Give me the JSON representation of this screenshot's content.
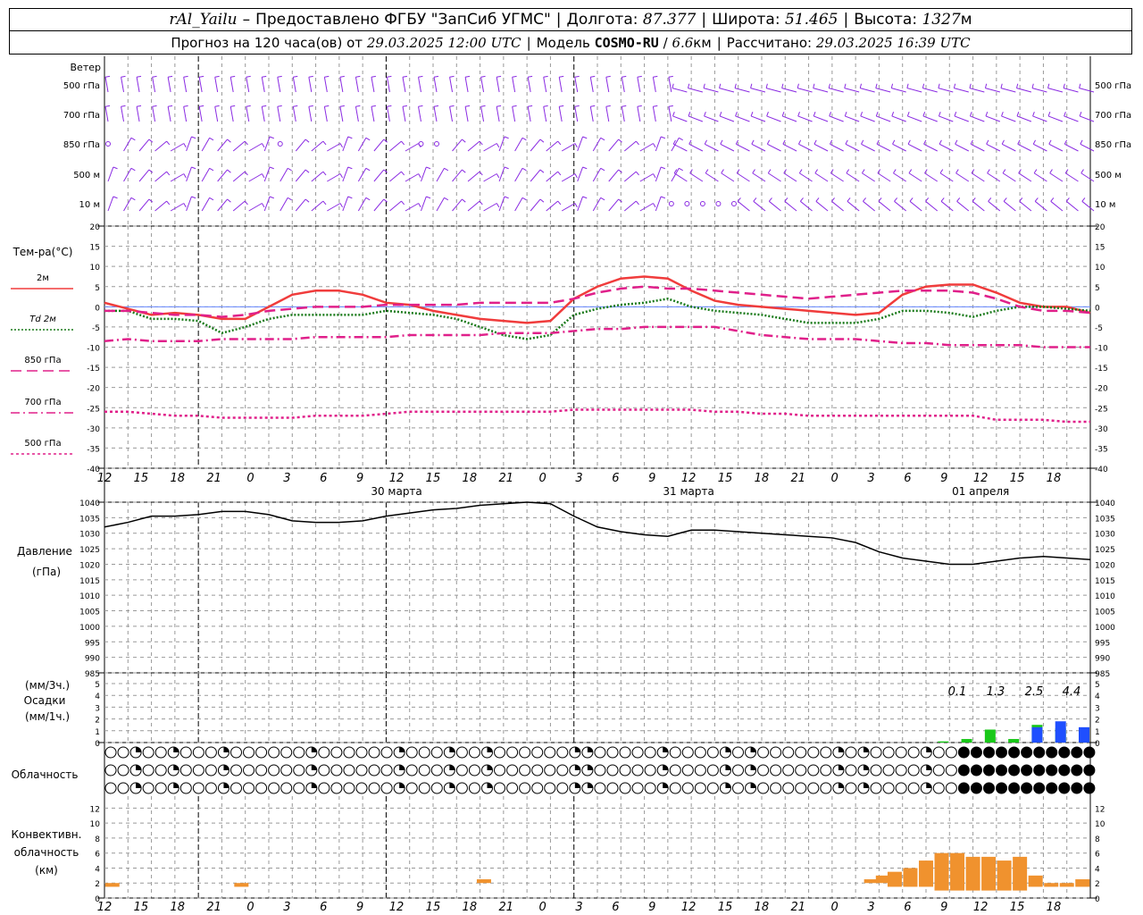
{
  "header": {
    "station": "rAl_Yailu",
    "provider": "Предоставлено ФГБУ \"ЗапСиб УГМС\"",
    "lon_label": "Долгота:",
    "lon": "87.377",
    "lat_label": "Широта:",
    "lat": "51.465",
    "alt_label": "Высота:",
    "alt": "1327",
    "alt_unit": "м",
    "forecast_label": "Прогноз на 120 часа(ов) от",
    "forecast_start": "29.03.2025 12:00 UTC",
    "model_label": "Модель",
    "model": "COSMO-RU",
    "resolution": "6.6",
    "res_unit": "км",
    "calc_label": "Рассчитано:",
    "calc_time": "29.03.2025 16:39 UTC"
  },
  "x_axis": {
    "ticks": [
      "12",
      "15",
      "18",
      "21",
      "0",
      "3",
      "6",
      "9",
      "12",
      "15",
      "18",
      "21",
      "0",
      "3",
      "6",
      "9",
      "12",
      "15",
      "18",
      "21",
      "0",
      "3",
      "6",
      "9",
      "12",
      "15",
      "18"
    ],
    "day_labels": [
      {
        "text": "30 марта",
        "tick_index": 8
      },
      {
        "text": "31 марта",
        "tick_index": 16
      },
      {
        "text": "01 апреля",
        "tick_index": 24
      }
    ],
    "midnight_tick_indices": [
      4,
      12,
      20
    ]
  },
  "panels": {
    "wind": {
      "title": "Ветер",
      "levels": [
        "500 гПа",
        "700 гПа",
        "850 гПа",
        "500 м",
        "10  м"
      ],
      "color": "#8a2be2"
    },
    "temp": {
      "title": "Тем-ра(°C)",
      "legend": [
        {
          "label": "2м",
          "color": "#f03c3c",
          "dash": "solid"
        },
        {
          "label": "Td  2м",
          "color": "#1a7a1a",
          "dash": "dotted"
        },
        {
          "label": "850 гПа",
          "color": "#e0208a",
          "dash": "dash"
        },
        {
          "label": "700 гПа",
          "color": "#e0208a",
          "dash": "dashdot"
        },
        {
          "label": "500 гПа",
          "color": "#e0208a",
          "dash": "dot"
        }
      ],
      "ticks": [
        "20",
        "15",
        "10",
        "5",
        "0",
        "-5",
        "-10",
        "-15",
        "-20",
        "-25",
        "-30",
        "-35",
        "-40"
      ]
    },
    "pressure": {
      "title": "Давление",
      "unit": "(гПа)",
      "ticks": [
        "1040",
        "1035",
        "1030",
        "1025",
        "1020",
        "1015",
        "1010",
        "1005",
        "1000",
        "995",
        "990",
        "985"
      ]
    },
    "precip": {
      "unit3": "(мм/3ч.)",
      "title": "Осадки",
      "unit1": "(мм/1ч.)",
      "ticks": [
        "5",
        "4",
        "3",
        "2",
        "1",
        "0"
      ],
      "totals": [
        "0.1",
        "1.3",
        "2.5",
        "4.4"
      ]
    },
    "cloud": {
      "title": "Облачность"
    },
    "conv": {
      "title1": "Конвективн.",
      "title2": "облачность",
      "unit": "(км)",
      "ticks": [
        "12",
        "10",
        "8",
        "6",
        "4",
        "2",
        "0"
      ]
    }
  },
  "chart_data": [
    {
      "type": "line",
      "title": "Тем-ра(°C)",
      "x_hours": [
        0,
        3,
        6,
        9,
        12,
        15,
        18,
        21,
        24,
        27,
        30,
        33,
        36,
        39,
        42,
        45,
        48,
        51,
        54,
        57,
        60,
        63,
        66,
        69,
        72,
        75,
        78,
        81,
        84,
        87,
        90,
        93,
        96,
        99,
        102,
        105,
        108,
        111,
        114,
        117,
        120,
        123,
        126
      ],
      "ylim": [
        -40,
        20
      ],
      "series": [
        {
          "name": "2м",
          "values": [
            1,
            -0.5,
            -2,
            -1.5,
            -2,
            -3,
            -3,
            0,
            3,
            4,
            4,
            3,
            1,
            0.5,
            -1,
            -2,
            -3,
            -3.5,
            -4,
            -3.5,
            2,
            5,
            7,
            7.5,
            7,
            4,
            1.5,
            0.5,
            0,
            -0.5,
            -1,
            -1.5,
            -2,
            -1.5,
            3,
            5,
            5.5,
            5.5,
            3.5,
            1,
            0,
            0,
            -1.5
          ]
        },
        {
          "name": "Td  2м",
          "values": [
            -1,
            -1,
            -3,
            -3,
            -3.5,
            -6.5,
            -5,
            -3,
            -2,
            -2,
            -2,
            -2,
            -1,
            -1.5,
            -2,
            -3,
            -5,
            -7,
            -8,
            -7,
            -2,
            -0.5,
            0.5,
            1,
            2,
            0,
            -1,
            -1.5,
            -2,
            -3,
            -4,
            -4,
            -4,
            -3,
            -1,
            -1,
            -1.5,
            -2.5,
            -1,
            0,
            0,
            -0.5,
            -1
          ]
        },
        {
          "name": "850 гПа",
          "values": [
            -1,
            -1,
            -1.5,
            -2,
            -2,
            -2.5,
            -2,
            -1,
            -0.5,
            0,
            0,
            0,
            0.5,
            0.5,
            0.5,
            0.5,
            1,
            1,
            1,
            1,
            2,
            3.5,
            4.5,
            5,
            4.5,
            4.5,
            4,
            3.5,
            3,
            2.5,
            2,
            2.5,
            3,
            3.5,
            4,
            4,
            4,
            3.5,
            2,
            0,
            -1,
            -1,
            -1.5
          ]
        },
        {
          "name": "700 гПа",
          "values": [
            -8.5,
            -8,
            -8.5,
            -8.5,
            -8.5,
            -8,
            -8,
            -8,
            -8,
            -7.5,
            -7.5,
            -7.5,
            -7.5,
            -7,
            -7,
            -7,
            -7,
            -6.5,
            -6.5,
            -6.5,
            -6,
            -5.5,
            -5.5,
            -5,
            -5,
            -5,
            -5,
            -6,
            -7,
            -7.5,
            -8,
            -8,
            -8,
            -8.5,
            -9,
            -9,
            -9.5,
            -9.5,
            -9.5,
            -9.5,
            -10,
            -10,
            -10
          ]
        },
        {
          "name": "500 гПа",
          "values": [
            -26,
            -26,
            -26.5,
            -27,
            -27,
            -27.5,
            -27.5,
            -27.5,
            -27.5,
            -27,
            -27,
            -27,
            -26.5,
            -26,
            -26,
            -26,
            -26,
            -26,
            -26,
            -26,
            -25.5,
            -25.5,
            -25.5,
            -25.5,
            -25.5,
            -25.5,
            -26,
            -26,
            -26.5,
            -26.5,
            -27,
            -27,
            -27,
            -27,
            -27,
            -27,
            -27,
            -27,
            -28,
            -28,
            -28,
            -28.5,
            -28.5
          ]
        }
      ]
    },
    {
      "type": "line",
      "title": "Давление",
      "x_hours": [
        0,
        3,
        6,
        9,
        12,
        15,
        18,
        21,
        24,
        27,
        30,
        33,
        36,
        39,
        42,
        45,
        48,
        51,
        54,
        57,
        60,
        63,
        66,
        69,
        72,
        75,
        78,
        81,
        84,
        87,
        90,
        93,
        96,
        99,
        102,
        105,
        108,
        111,
        114,
        117,
        120,
        123,
        126
      ],
      "ylim": [
        985,
        1040
      ],
      "series": [
        {
          "name": "",
          "values": [
            1032,
            1033.5,
            1035.5,
            1035.5,
            1036,
            1037,
            1037,
            1036,
            1034,
            1033.5,
            1033.5,
            1034,
            1035.5,
            1036.5,
            1037.5,
            1038,
            1039,
            1039.5,
            1040,
            1039.5,
            1035.5,
            1032,
            1030.5,
            1029.5,
            1029,
            1031,
            1031,
            1030.5,
            1030,
            1029.5,
            1029,
            1028.5,
            1027,
            1024,
            1022,
            1021,
            1020,
            1020,
            1021,
            1022,
            1022.5,
            1022,
            1021.5
          ]
        }
      ]
    },
    {
      "type": "bar",
      "title": "Осадки",
      "x_hours": [
        108,
        111,
        114,
        117,
        120,
        123,
        126
      ],
      "ylim": [
        0,
        5
      ],
      "series": [
        {
          "name": "",
          "color": "#19c819",
          "values": [
            0.1,
            0.3,
            1.1,
            0.3,
            1.5,
            1.2,
            0.4
          ]
        },
        {
          "name": "",
          "color": "#1f4fff",
          "values": [
            0,
            0,
            0,
            0,
            1.3,
            1.8,
            1.3
          ]
        }
      ]
    },
    {
      "type": "bar",
      "title": "Конвективн. облачность",
      "ylim": [
        0,
        13
      ],
      "bars": [
        {
          "x": 1,
          "base": 1.5,
          "top": 2
        },
        {
          "x": 17.5,
          "base": 1.5,
          "top": 2
        },
        {
          "x": 48.5,
          "base": 2,
          "top": 2.5
        },
        {
          "x": 98,
          "base": 2,
          "top": 2.5
        },
        {
          "x": 99.5,
          "base": 2,
          "top": 3
        },
        {
          "x": 101,
          "base": 1.5,
          "top": 3.5
        },
        {
          "x": 103,
          "base": 1.5,
          "top": 4
        },
        {
          "x": 105,
          "base": 1.5,
          "top": 5
        },
        {
          "x": 107,
          "base": 1,
          "top": 6
        },
        {
          "x": 109,
          "base": 1,
          "top": 6
        },
        {
          "x": 111,
          "base": 1,
          "top": 5.5
        },
        {
          "x": 113,
          "base": 1,
          "top": 5.5
        },
        {
          "x": 115,
          "base": 1,
          "top": 5
        },
        {
          "x": 117,
          "base": 1,
          "top": 5.5
        },
        {
          "x": 119,
          "base": 1.5,
          "top": 3
        },
        {
          "x": 121,
          "base": 1.5,
          "top": 2
        },
        {
          "x": 123,
          "base": 1.5,
          "top": 2
        },
        {
          "x": 125,
          "base": 1.5,
          "top": 2.5
        }
      ]
    }
  ]
}
